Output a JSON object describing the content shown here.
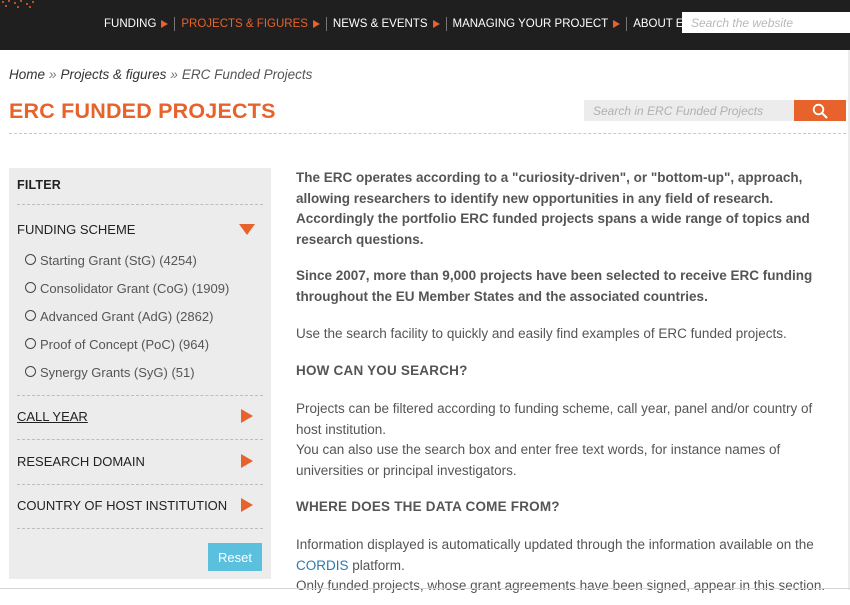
{
  "nav": {
    "items": [
      {
        "label": "FUNDING",
        "active": false
      },
      {
        "label": "PROJECTS & FIGURES",
        "active": true
      },
      {
        "label": "NEWS & EVENTS",
        "active": false
      },
      {
        "label": "MANAGING YOUR PROJECT",
        "active": false
      },
      {
        "label": "ABOUT ERC",
        "active": false
      }
    ],
    "search_placeholder": "Search the website"
  },
  "breadcrumb": {
    "home": "Home",
    "sep1": "»",
    "section": "Projects & figures",
    "sep2": "»",
    "current": "ERC Funded Projects"
  },
  "page": {
    "title": "ERC FUNDED PROJECTS",
    "search_placeholder": "Search in ERC Funded Projects",
    "search_icon": "magnifier-icon"
  },
  "filter": {
    "heading": "FILTER",
    "funding_scheme": {
      "label": "FUNDING SCHEME",
      "options": [
        "Starting Grant (StG) (4254)",
        "Consolidator Grant (CoG) (1909)",
        "Advanced Grant (AdG) (2862)",
        "Proof of Concept (PoC) (964)",
        "Synergy Grants (SyG) (51)"
      ]
    },
    "call_year": "CALL YEAR",
    "research_domain": "RESEARCH DOMAIN",
    "country": "COUNTRY OF HOST INSTITUTION",
    "reset": "Reset"
  },
  "content": {
    "intro": "The ERC operates according to a \"curiosity-driven\", or \"bottom-up\", approach, allowing researchers to identify new opportunities in any field of research. Accordingly the portfolio ERC funded projects spans a wide range of topics and research questions.",
    "since": "Since 2007, more than 9,000 projects have been selected to receive ERC funding throughout the EU Member States and the associated countries.",
    "use": "Use the search facility to quickly and easily find examples of ERC funded projects.",
    "how_heading": "HOW CAN YOU SEARCH?",
    "how_p1": "Projects can be filtered according to funding scheme, call year, panel and/or country of host institution.",
    "how_p2": "You can also use the search box and enter free text words, for instance names of universities or principal investigators.",
    "where_heading": "WHERE DOES THE DATA COME FROM?",
    "where_pre": "Information displayed is automatically updated through the information available on the",
    "cordis": "CORDIS",
    "where_post": "platform.",
    "only": "Only funded projects, whose grant agreements have been signed, appear in this section."
  },
  "colors": {
    "accent": "#e8622c",
    "nav_bg": "#1f1f1f",
    "reset_button": "#5bc0de",
    "link": "#2a7ab0"
  }
}
